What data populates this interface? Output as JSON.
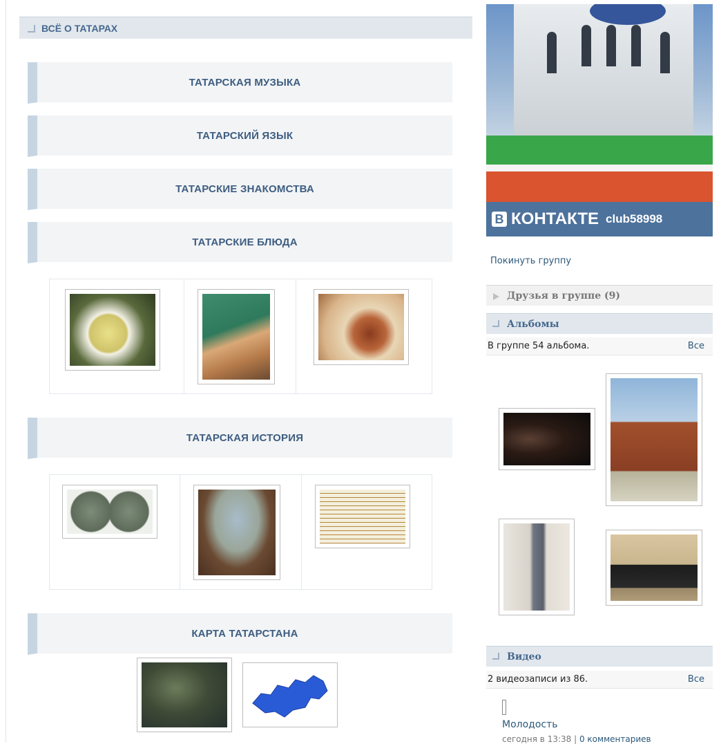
{
  "section": {
    "title": "ВСЁ О ТАТАРАХ"
  },
  "menu": [
    {
      "label": "ТАТАРСКАЯ МУЗЫКА"
    },
    {
      "label": "ТАТАРСКИЙ ЯЗЫК"
    },
    {
      "label": "ТАТАРСКИЕ ЗНАКОМСТВА"
    },
    {
      "label": "ТАТАРСКИЕ БЛЮДА"
    },
    {
      "label": "ТАТАРСКАЯ ИСТОРИЯ"
    },
    {
      "label": "КАРТА ТАТАРСТАНА"
    }
  ],
  "banner": {
    "vk_logo": "В",
    "vk_name": "КОНТАКТЕ",
    "club": "club58998"
  },
  "group": {
    "leave": "Покинуть группу"
  },
  "friends": {
    "title": "Друзья в группе (9)"
  },
  "albums": {
    "title": "Альбомы",
    "summary": "В группе 54 альбома.",
    "all": "Все"
  },
  "video": {
    "title": "Видео",
    "summary": "2 видеозаписи из 86.",
    "all": "Все",
    "item_title": "Молодость",
    "item_date": "сегодня в 13:38",
    "item_sep": "|",
    "item_comments": "0 комментариев"
  },
  "colors": {
    "accent": "#45688e",
    "header_bg": "#e1e7ed",
    "menu_bg": "#f2f4f6",
    "menu_border": "#c7d5e2",
    "vk_blue": "#4d729c"
  }
}
